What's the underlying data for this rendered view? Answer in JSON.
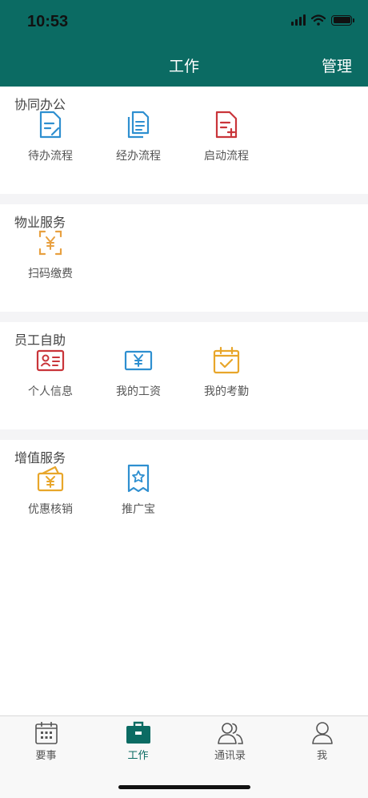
{
  "status_bar": {
    "time": "10:53"
  },
  "header": {
    "title": "工作",
    "manage": "管理"
  },
  "sections": [
    {
      "title": "协同办公",
      "items": [
        {
          "label": "待办流程",
          "icon": "document-edit-icon",
          "color": "#2e8fd0"
        },
        {
          "label": "经办流程",
          "icon": "documents-copy-icon",
          "color": "#2e8fd0"
        },
        {
          "label": "启动流程",
          "icon": "document-add-icon",
          "color": "#c9353a"
        }
      ]
    },
    {
      "title": "物业服务",
      "items": [
        {
          "label": "扫码缴费",
          "icon": "scan-yuan-icon",
          "color": "#e8a040"
        }
      ]
    },
    {
      "title": "员工自助",
      "items": [
        {
          "label": "个人信息",
          "icon": "id-card-icon",
          "color": "#c9353a"
        },
        {
          "label": "我的工资",
          "icon": "salary-yuan-icon",
          "color": "#2e8fd0"
        },
        {
          "label": "我的考勤",
          "icon": "calendar-check-icon",
          "color": "#e8a62a"
        }
      ]
    },
    {
      "title": "增值服务",
      "items": [
        {
          "label": "优惠核销",
          "icon": "wallet-yuan-icon",
          "color": "#e8a62a"
        },
        {
          "label": "推广宝",
          "icon": "star-receipt-icon",
          "color": "#2e8fd0"
        }
      ]
    }
  ],
  "tabbar": [
    {
      "label": "要事",
      "icon": "calendar-grid-icon",
      "active": false
    },
    {
      "label": "工作",
      "icon": "briefcase-icon",
      "active": true,
      "color": "#0b6b63"
    },
    {
      "label": "通讯录",
      "icon": "contacts-icon",
      "active": false
    },
    {
      "label": "我",
      "icon": "person-icon",
      "active": false
    }
  ]
}
